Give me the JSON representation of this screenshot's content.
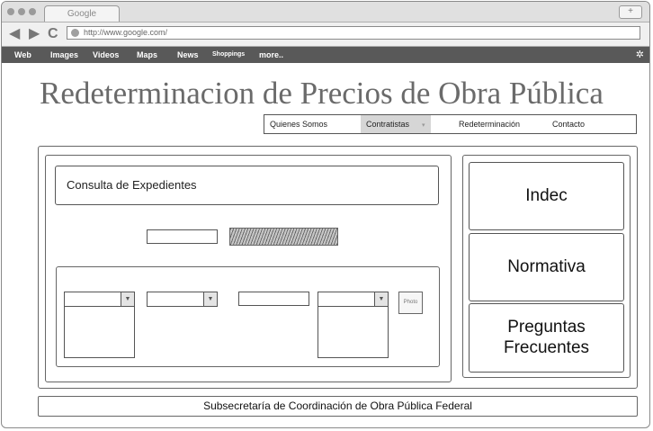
{
  "browser": {
    "tab_title": "Google",
    "new_tab_label": "+",
    "url": "http://www.google.com/",
    "back_icon": "◀",
    "forward_icon": "▶",
    "reload_icon": "C"
  },
  "google_bar": {
    "links": [
      "Web",
      "Images",
      "Videos",
      "Maps",
      "News",
      "Shoppings",
      "more.."
    ],
    "settings_icon": "✲"
  },
  "page": {
    "title": "Redeterminacion de Precios de Obra Pública",
    "menu": {
      "items": [
        "Quienes Somos",
        "Contratistas",
        "Redeterminación",
        "Contacto"
      ],
      "selected": "Contratistas",
      "caret": "▾"
    },
    "consulta_label": "Consulta de Expedientes",
    "dropdown_arrow": "▼",
    "photo_label": "Photo",
    "sidebar": [
      "Indec",
      "Normativa",
      "Preguntas Frecuentes"
    ],
    "footer": "Subsecretaría de Coordinación de Obra Pública Federal"
  }
}
